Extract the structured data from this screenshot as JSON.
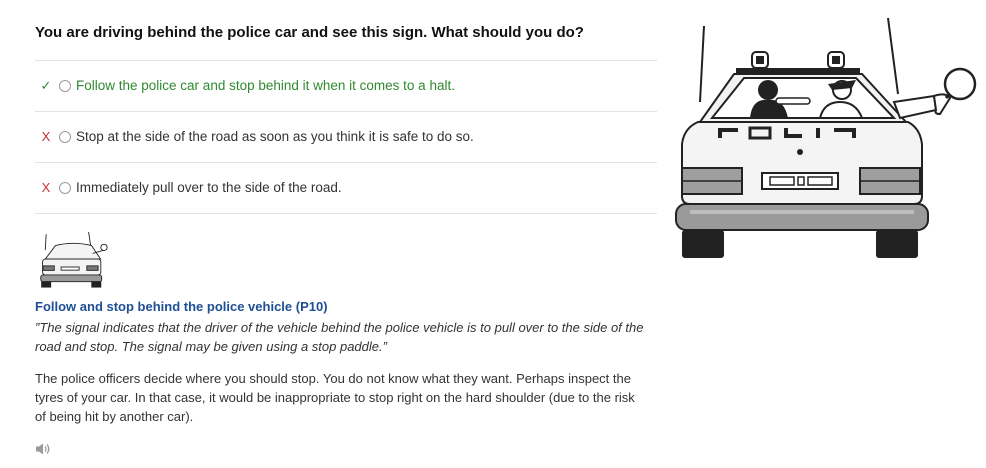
{
  "question": "You are driving behind the police car and see this sign. What should you do?",
  "answers": [
    {
      "mark": "✓",
      "text": "Follow the police car and stop behind it when it comes to a halt.",
      "status": "correct"
    },
    {
      "mark": "X",
      "text": "Stop at the side of the road as soon as you think it is safe to do so.",
      "status": "wrong"
    },
    {
      "mark": "X",
      "text": "Immediately pull over to the side of the road.",
      "status": "wrong"
    }
  ],
  "explanation": {
    "title": "Follow and stop behind the police vehicle (P10)",
    "quote": "”The signal indicates that the driver of the vehicle behind the police vehicle is to pull over to the side of the road and stop. The signal may be given using a stop paddle.”",
    "body": "The police officers decide where you should stop. You do not know what they want. Perhaps inspect the tyres of your car. In that case, it would be inappropriate to stop right on the hard shoulder (due to the risk of being hit by another car)."
  },
  "car_plate_text": "POLIS",
  "icons": {
    "correct": "check-icon",
    "wrong": "x-icon",
    "audio": "speaker-icon"
  },
  "colors": {
    "correct": "#2f8a2f",
    "wrong": "#c83232",
    "title": "#1e4f95"
  }
}
